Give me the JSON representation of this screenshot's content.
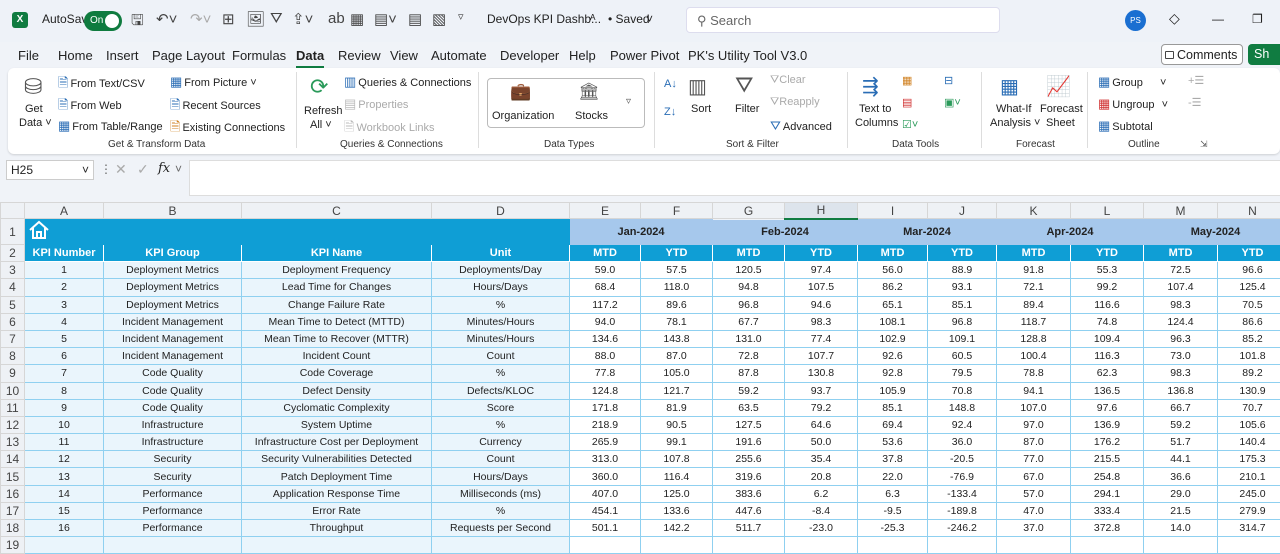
{
  "titlebar": {
    "autosave_label": "AutoSave",
    "autosave_state": "On",
    "doc_title": "DevOps KPI Dashb...",
    "save_status": "• Saved",
    "search_placeholder": "Search",
    "avatar_initials": "PS"
  },
  "tabs": [
    "File",
    "Home",
    "Insert",
    "Page Layout",
    "Formulas",
    "Data",
    "Review",
    "View",
    "Automate",
    "Developer",
    "Help",
    "Power Pivot",
    "PK's Utility Tool V3.0"
  ],
  "active_tab": "Data",
  "comments_label": "Comments",
  "share_label": "Sh",
  "ribbon": {
    "get_data": "Get",
    "get_data2": "Data ˅",
    "from_text": "From Text/CSV",
    "from_web": "From Web",
    "from_table": "From Table/Range",
    "from_picture": "From Picture ˅",
    "recent_sources": "Recent Sources",
    "existing_connections": "Existing Connections",
    "group_get": "Get & Transform Data",
    "refresh": "Refresh",
    "refresh2": "All ˅",
    "queries": "Queries & Connections",
    "properties": "Properties",
    "workbook_links": "Workbook Links",
    "group_queries": "Queries & Connections",
    "organization": "Organization",
    "stocks": "Stocks",
    "group_datatypes": "Data Types",
    "sort": "Sort",
    "filter": "Filter",
    "clear": "Clear",
    "reapply": "Reapply",
    "advanced": "Advanced",
    "group_sort": "Sort & Filter",
    "text_to": "Text to",
    "columns": "Columns",
    "group_datatools": "Data Tools",
    "whatif": "What-If",
    "analysis": "Analysis ˅",
    "forecast": "Forecast",
    "sheet": "Sheet",
    "group_forecast": "Forecast",
    "group": "Group",
    "ungroup": "Ungroup",
    "subtotal": "Subtotal",
    "group_outline": "Outline"
  },
  "formula_bar": {
    "name_box": "H25",
    "fx": "fx",
    "value": ""
  },
  "columns": [
    "A",
    "B",
    "C",
    "D",
    "E",
    "F",
    "G",
    "H",
    "I",
    "J",
    "K",
    "L",
    "M",
    "N"
  ],
  "selected_column": "H",
  "months": [
    "Jan-2024",
    "Feb-2024",
    "Mar-2024",
    "Apr-2024",
    "May-2024"
  ],
  "headers": [
    "KPI Number",
    "KPI Group",
    "KPI Name",
    "Unit",
    "MTD",
    "YTD",
    "MTD",
    "YTD",
    "MTD",
    "YTD",
    "MTD",
    "YTD",
    "MTD",
    "YTD"
  ],
  "rows": [
    [
      "1",
      "Deployment Metrics",
      "Deployment Frequency",
      "Deployments/Day",
      "59.0",
      "57.5",
      "120.5",
      "97.4",
      "56.0",
      "88.9",
      "91.8",
      "55.3",
      "72.5",
      "96.6"
    ],
    [
      "2",
      "Deployment Metrics",
      "Lead Time for Changes",
      "Hours/Days",
      "68.4",
      "118.0",
      "94.8",
      "107.5",
      "86.2",
      "93.1",
      "72.1",
      "99.2",
      "107.4",
      "125.4"
    ],
    [
      "3",
      "Deployment Metrics",
      "Change Failure Rate",
      "%",
      "117.2",
      "89.6",
      "96.8",
      "94.6",
      "65.1",
      "85.1",
      "89.4",
      "116.6",
      "98.3",
      "70.5"
    ],
    [
      "4",
      "Incident Management",
      "Mean Time to Detect (MTTD)",
      "Minutes/Hours",
      "94.0",
      "78.1",
      "67.7",
      "98.3",
      "108.1",
      "96.8",
      "118.7",
      "74.8",
      "124.4",
      "86.6"
    ],
    [
      "5",
      "Incident Management",
      "Mean Time to Recover (MTTR)",
      "Minutes/Hours",
      "134.6",
      "143.8",
      "131.0",
      "77.4",
      "102.9",
      "109.1",
      "128.8",
      "109.4",
      "96.3",
      "85.2"
    ],
    [
      "6",
      "Incident Management",
      "Incident Count",
      "Count",
      "88.0",
      "87.0",
      "72.8",
      "107.7",
      "92.6",
      "60.5",
      "100.4",
      "116.3",
      "73.0",
      "101.8"
    ],
    [
      "7",
      "Code Quality",
      "Code Coverage",
      "%",
      "77.8",
      "105.0",
      "87.8",
      "130.8",
      "92.8",
      "79.5",
      "78.8",
      "62.3",
      "98.3",
      "89.2"
    ],
    [
      "8",
      "Code Quality",
      "Defect Density",
      "Defects/KLOC",
      "124.8",
      "121.7",
      "59.2",
      "93.7",
      "105.9",
      "70.8",
      "94.1",
      "136.5",
      "136.8",
      "130.9"
    ],
    [
      "9",
      "Code Quality",
      "Cyclomatic Complexity",
      "Score",
      "171.8",
      "81.9",
      "63.5",
      "79.2",
      "85.1",
      "148.8",
      "107.0",
      "97.6",
      "66.7",
      "70.7"
    ],
    [
      "10",
      "Infrastructure",
      "System Uptime",
      "%",
      "218.9",
      "90.5",
      "127.5",
      "64.6",
      "69.4",
      "92.4",
      "97.0",
      "136.9",
      "59.2",
      "105.6"
    ],
    [
      "11",
      "Infrastructure",
      "Infrastructure Cost per Deployment",
      "Currency",
      "265.9",
      "99.1",
      "191.6",
      "50.0",
      "53.6",
      "36.0",
      "87.0",
      "176.2",
      "51.7",
      "140.4"
    ],
    [
      "12",
      "Security",
      "Security Vulnerabilities Detected",
      "Count",
      "313.0",
      "107.8",
      "255.6",
      "35.4",
      "37.8",
      "-20.5",
      "77.0",
      "215.5",
      "44.1",
      "175.3"
    ],
    [
      "13",
      "Security",
      "Patch Deployment Time",
      "Hours/Days",
      "360.0",
      "116.4",
      "319.6",
      "20.8",
      "22.0",
      "-76.9",
      "67.0",
      "254.8",
      "36.6",
      "210.1"
    ],
    [
      "14",
      "Performance",
      "Application Response Time",
      "Milliseconds (ms)",
      "407.0",
      "125.0",
      "383.6",
      "6.2",
      "6.3",
      "-133.4",
      "57.0",
      "294.1",
      "29.0",
      "245.0"
    ],
    [
      "15",
      "Performance",
      "Error Rate",
      "%",
      "454.1",
      "133.6",
      "447.6",
      "-8.4",
      "-9.5",
      "-189.8",
      "47.0",
      "333.4",
      "21.5",
      "279.9"
    ],
    [
      "16",
      "Performance",
      "Throughput",
      "Requests per Second",
      "501.1",
      "142.2",
      "511.7",
      "-23.0",
      "-25.3",
      "-246.2",
      "37.0",
      "372.8",
      "14.0",
      "314.7"
    ]
  ],
  "colors": {
    "accent": "#107c41",
    "header_blue": "#0f9ed5",
    "month_blue": "#a6c8ec",
    "label_cell": "#eaf5fc"
  }
}
